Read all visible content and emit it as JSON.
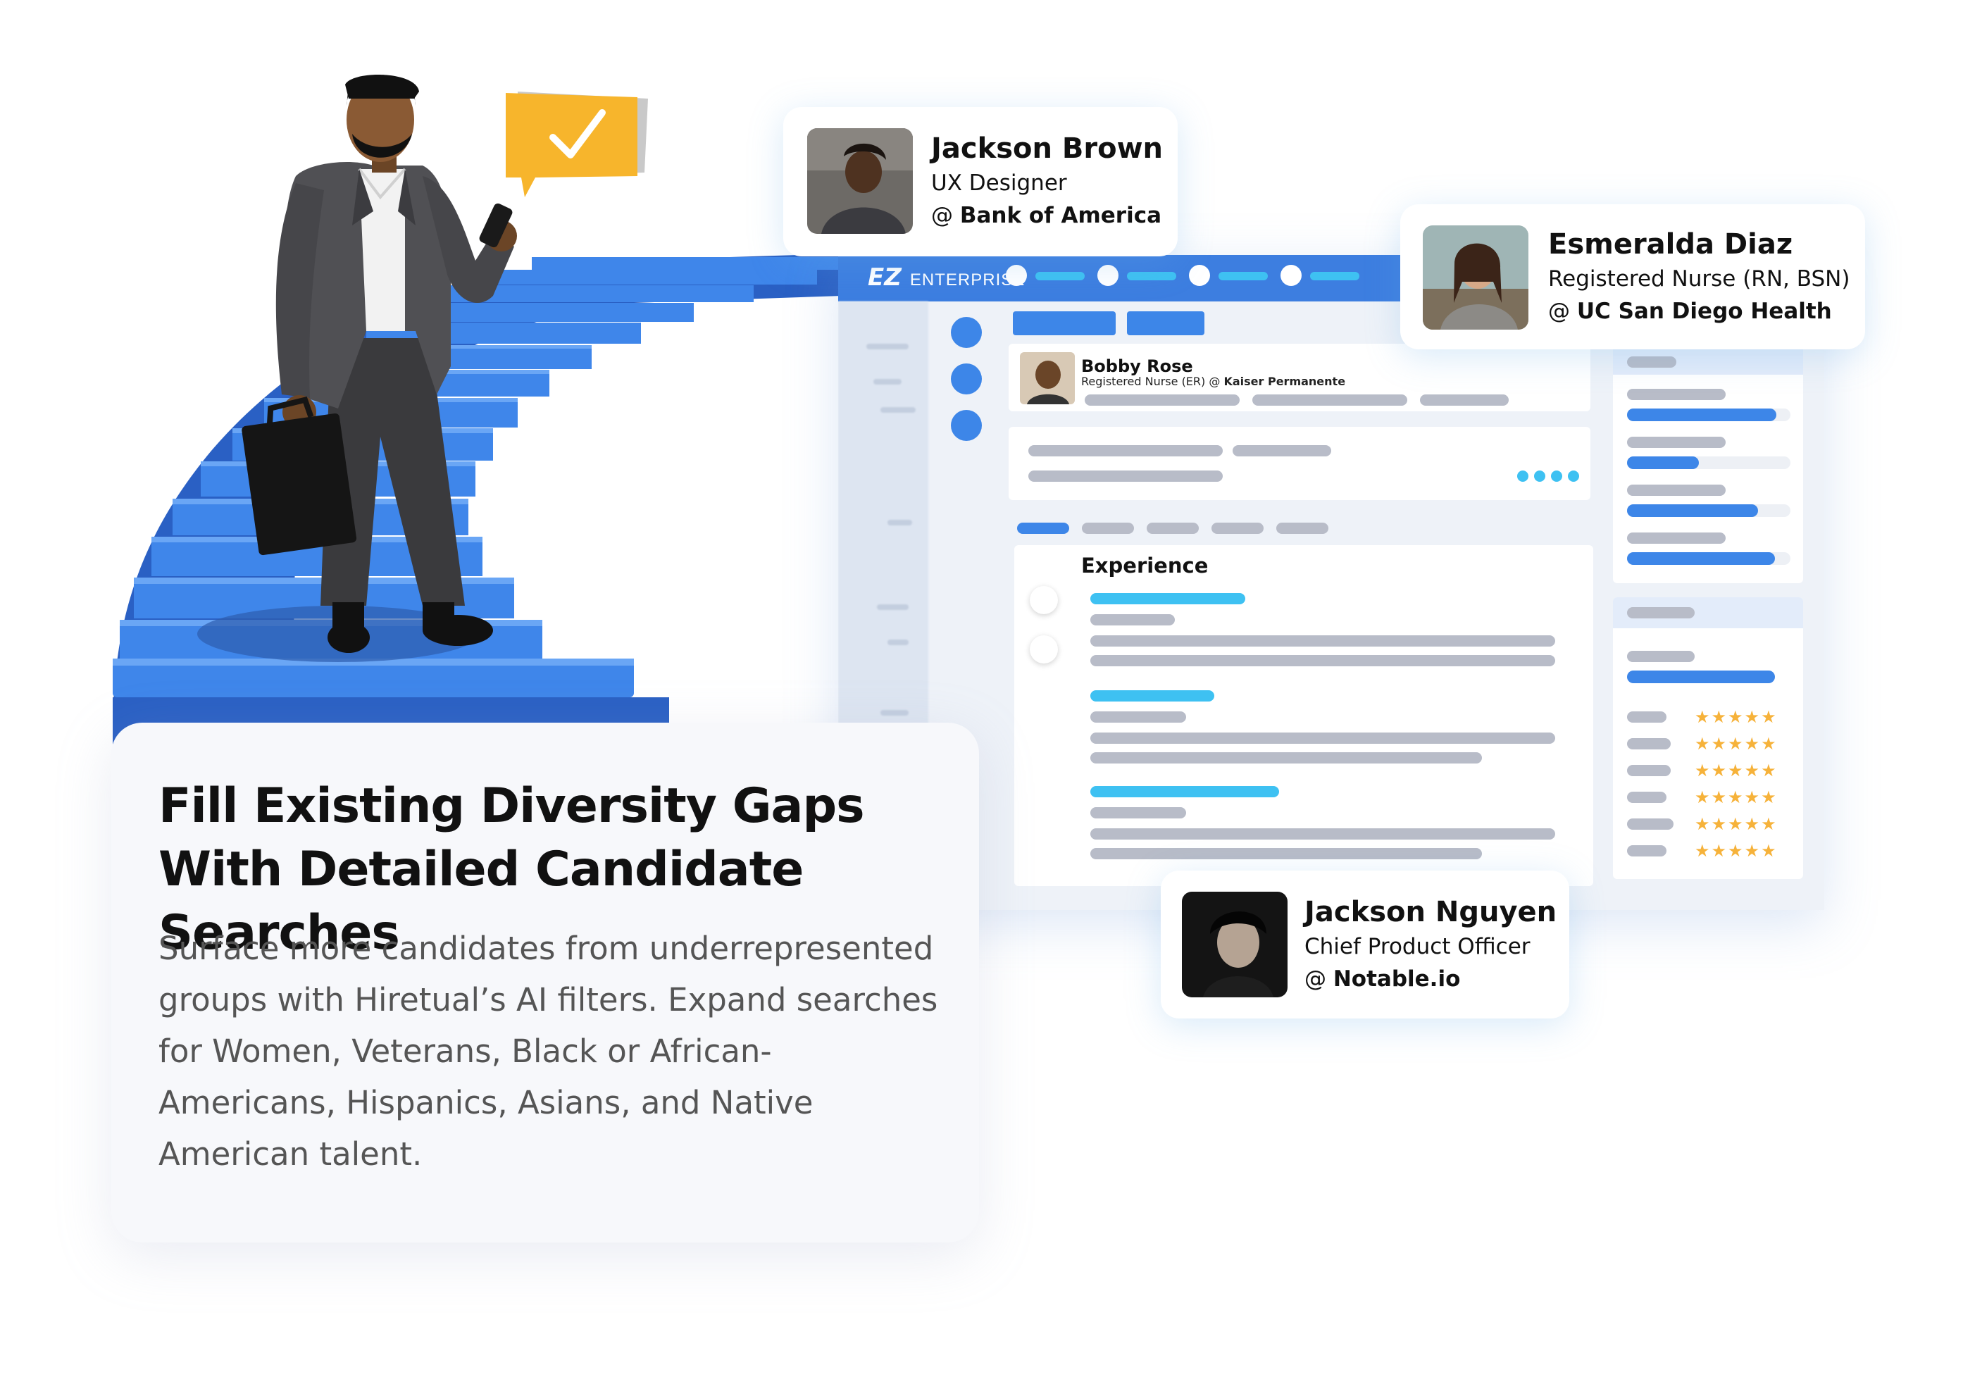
{
  "app": {
    "brand_logo": "EZ",
    "brand_name": "ENTERPRISE",
    "mini_card": {
      "name": "Bobby Rose",
      "role_prefix": "Registered Nurse (ER) @ ",
      "company": "Kaiser Permanente"
    },
    "section_title": "Experience"
  },
  "profiles": [
    {
      "name": "Jackson Brown",
      "role": "UX Designer",
      "at": "@ ",
      "company": "Bank of America"
    },
    {
      "name": "Esmeralda Diaz",
      "role": "Registered Nurse (RN, BSN)",
      "at": "@ ",
      "company": "UC San Diego Health"
    },
    {
      "name": "Jackson Nguyen",
      "role": "Chief Product Officer",
      "at": "@ ",
      "company": "Notable.io"
    }
  ],
  "ratings": {
    "stars": "★★★★★",
    "rows": 6
  },
  "notification_icon": "check-icon",
  "headline": "Fill Existing Diversity Gaps With Detailed Candidate Searches",
  "body": "Surface more candidates from underrepresented groups with Hiretual’s AI filters. Expand searches for Women, Veterans, Black or African-Americans, Hispanics, Asians, and Native American talent.",
  "colors": {
    "primary_blue": "#3d86e8",
    "accent_cyan": "#3ec1f2",
    "star_gold": "#f6b23a",
    "notification_yellow": "#f7b52c",
    "stair_blue": "#3d7ee0"
  }
}
